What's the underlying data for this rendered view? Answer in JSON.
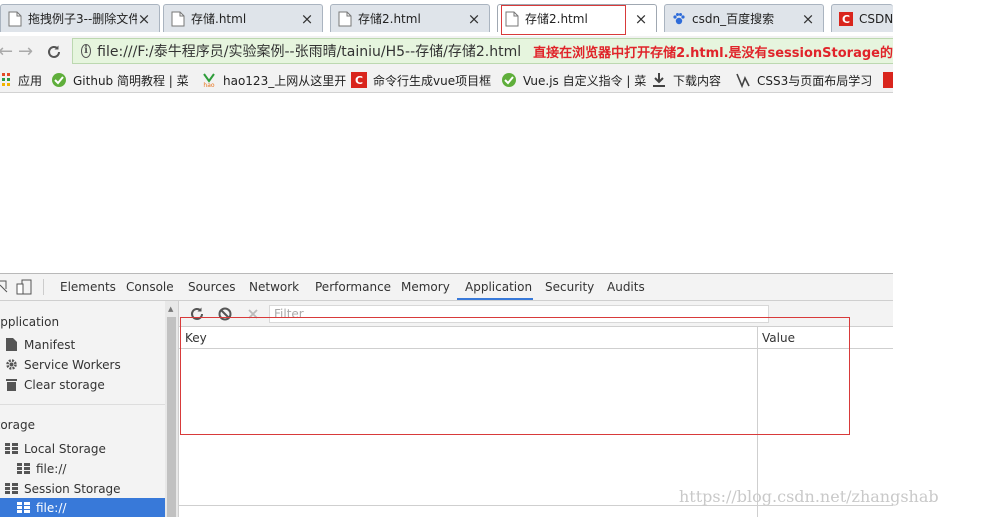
{
  "tabs": [
    {
      "title": "拖拽例子3--删除文件",
      "active": false
    },
    {
      "title": "存储.html",
      "active": false
    },
    {
      "title": "存储2.html",
      "active": false
    },
    {
      "title": "存储2.html",
      "active": true
    },
    {
      "title": "csdn_百度搜索",
      "active": false
    },
    {
      "title": "CSDN-",
      "active": false
    }
  ],
  "close_glyph": "×",
  "address": {
    "back_glyph": "←",
    "forward_glyph": "→",
    "url": "file:///F:/泰牛程序员/实验案例--张雨晴/tainiu/H5--存储/存储2.html",
    "annotation": "直接在浏览器中打开存储2.html.是没有sessionStorage的",
    "annotation_color": "#e0242a"
  },
  "bookmarks": [
    {
      "label": "应用",
      "icon": "apps-grid-icon"
    },
    {
      "label": "Github 简明教程 | 菜",
      "icon": "runoob-icon"
    },
    {
      "label": "hao123_上网从这里开",
      "icon": "hao123-icon"
    },
    {
      "label": "命令行生成vue项目框",
      "icon": "csdn-icon"
    },
    {
      "label": "Vue.js 自定义指令 | 菜",
      "icon": "runoob-icon"
    },
    {
      "label": "下载内容",
      "icon": "download-icon"
    },
    {
      "label": "CSS3与页面布局学习",
      "icon": "cnblogs-icon"
    }
  ],
  "devtools": {
    "tabs": [
      "Elements",
      "Console",
      "Sources",
      "Network",
      "Performance",
      "Memory",
      "Application",
      "Security",
      "Audits"
    ],
    "active_tab": "Application",
    "sidebar": {
      "application_header": "Application",
      "application_items": [
        "Manifest",
        "Service Workers",
        "Clear storage"
      ],
      "storage_header": "Storage",
      "storage_items": [
        {
          "label": "Local Storage",
          "selected": false
        },
        {
          "label": "file://",
          "selected": false
        },
        {
          "label": "Session Storage",
          "selected": false
        },
        {
          "label": "file://",
          "selected": true
        }
      ]
    },
    "filter_placeholder": "Filter",
    "columns": [
      "Key",
      "Value"
    ]
  },
  "watermark": "https://blog.csdn.net/zhangshab",
  "colors": {
    "accent": "#3879d9",
    "highlight_border": "#d83a3a",
    "omnibox_bg": "#e6f5de"
  }
}
